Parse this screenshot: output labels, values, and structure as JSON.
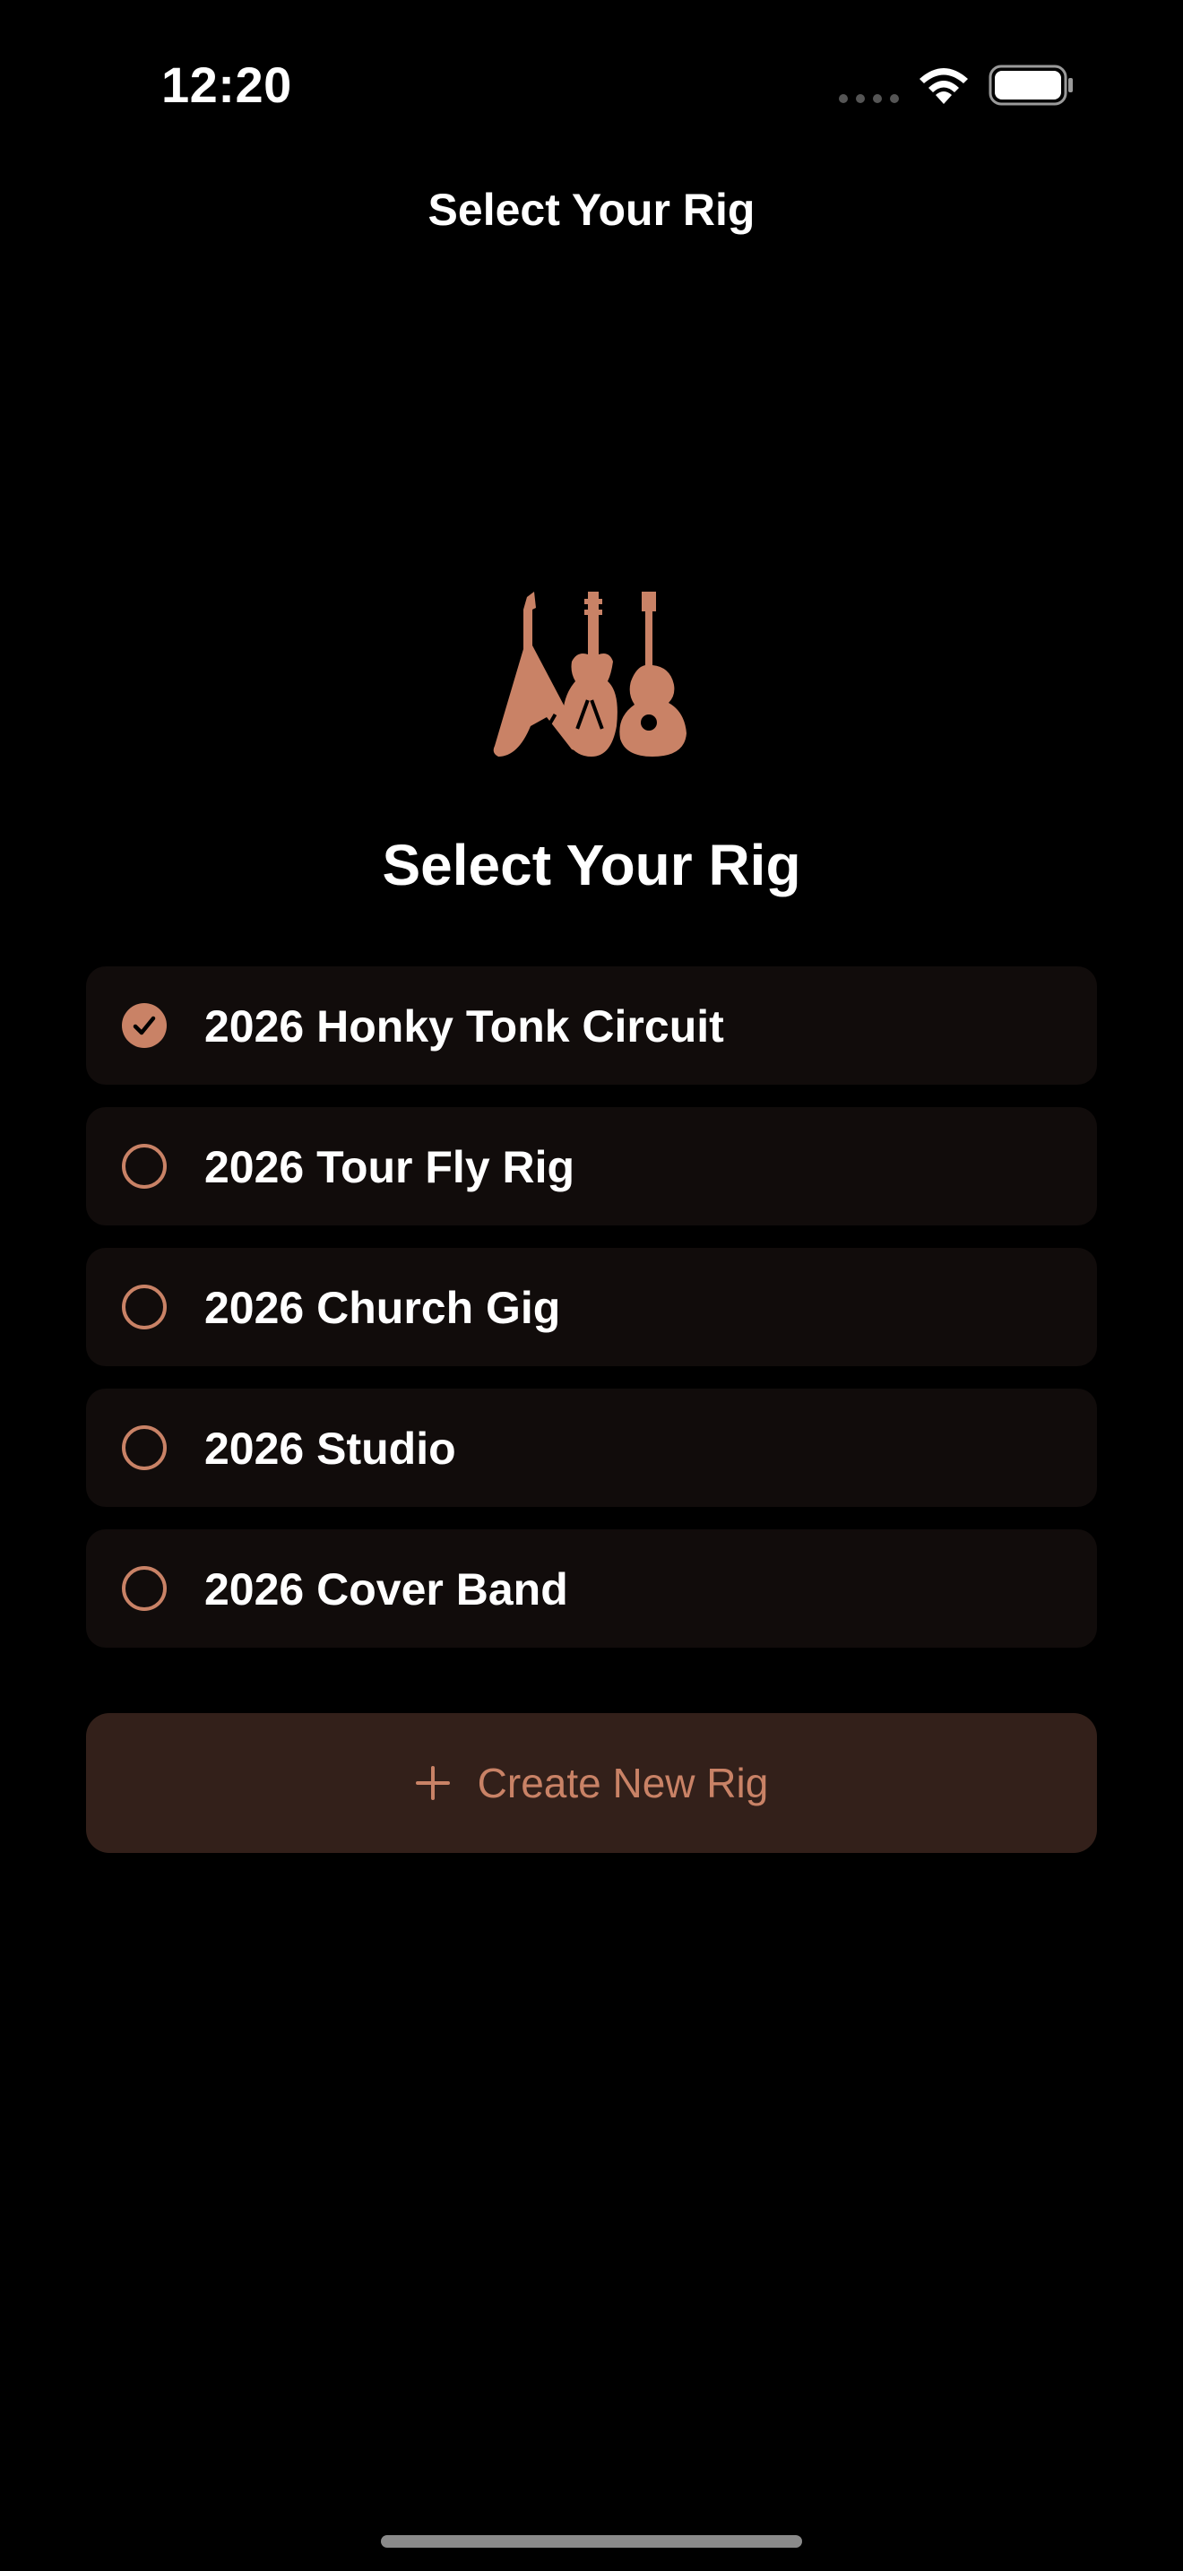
{
  "status_bar": {
    "time": "12:20"
  },
  "nav": {
    "title": "Select Your Rig"
  },
  "hero": {
    "icon": "guitars-icon",
    "heading": "Select Your Rig"
  },
  "rigs": [
    {
      "label": "2026 Honky Tonk Circuit",
      "selected": true
    },
    {
      "label": "2026 Tour Fly Rig",
      "selected": false
    },
    {
      "label": "2026 Church Gig",
      "selected": false
    },
    {
      "label": "2026 Studio",
      "selected": false
    },
    {
      "label": "2026 Cover Band",
      "selected": false
    }
  ],
  "create_button": {
    "icon": "plus-icon",
    "label": "Create New Rig"
  },
  "colors": {
    "accent": "#c98266",
    "background": "#000000",
    "row_background": "#110c0b",
    "button_background": "#33201a"
  }
}
